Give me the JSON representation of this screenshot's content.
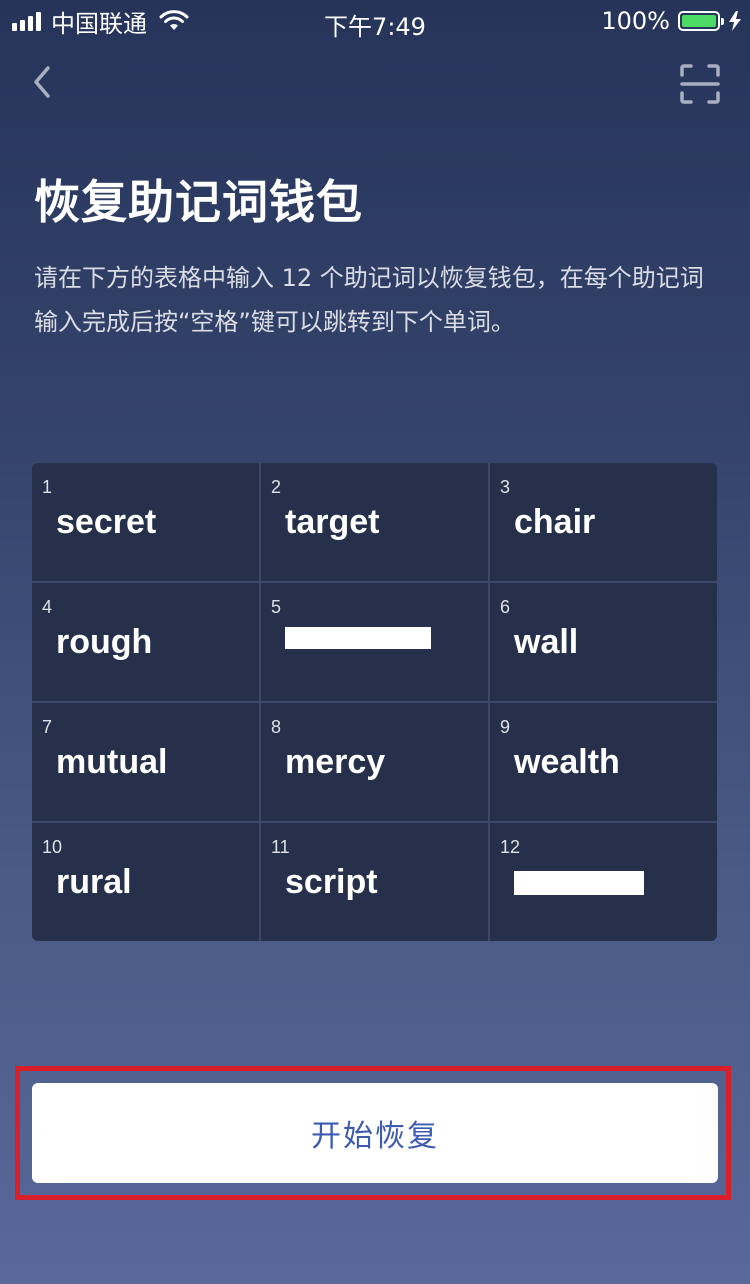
{
  "status_bar": {
    "carrier": "中国联通",
    "time": "下午7:49",
    "battery_percent": "100%",
    "battery_level": 1.0,
    "icons": [
      "signal-icon",
      "wifi-icon",
      "battery-icon",
      "charging-icon"
    ]
  },
  "nav": {
    "back_icon": "chevron-left-icon",
    "scan_icon": "scan-icon"
  },
  "page": {
    "title": "恢复助记词钱包",
    "description": "请在下方的表格中输入 12 个助记词以恢复钱包，在每个助记词输入完成后按“空格”键可以跳转到下个单词。"
  },
  "mnemonic": {
    "words": [
      {
        "index": "1",
        "word": "secret"
      },
      {
        "index": "2",
        "word": "target"
      },
      {
        "index": "3",
        "word": "chair"
      },
      {
        "index": "4",
        "word": "rough"
      },
      {
        "index": "5",
        "word": ""
      },
      {
        "index": "6",
        "word": "wall"
      },
      {
        "index": "7",
        "word": "mutual"
      },
      {
        "index": "8",
        "word": "mercy"
      },
      {
        "index": "9",
        "word": "wealth"
      },
      {
        "index": "10",
        "word": "rural"
      },
      {
        "index": "11",
        "word": "script"
      },
      {
        "index": "12",
        "word": ""
      }
    ]
  },
  "action": {
    "start_label": "开始恢复"
  },
  "colors": {
    "background_top": "#26345a",
    "background_bottom": "#58699a",
    "cell": "#26304a",
    "button_text": "#3d5bb0",
    "highlight_border": "#d9202a",
    "battery_fill": "#4cd964"
  }
}
